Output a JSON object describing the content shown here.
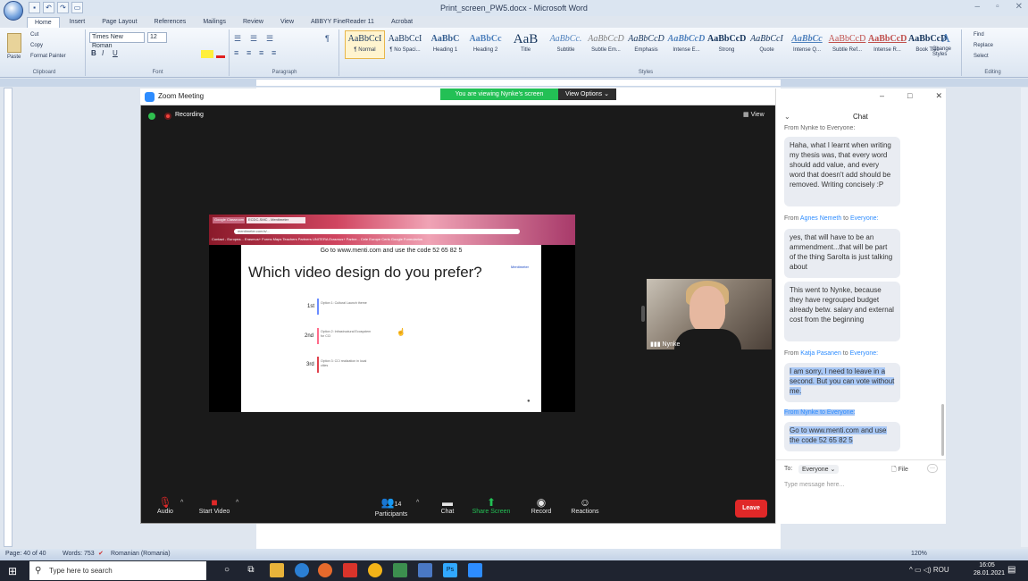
{
  "word": {
    "title": "Print_screen_PW5.docx - Microsoft Word",
    "tabs": [
      "Home",
      "Insert",
      "Page Layout",
      "References",
      "Mailings",
      "Review",
      "View",
      "ABBYY FineReader 11",
      "Acrobat"
    ],
    "clipboard": {
      "paste": "Paste",
      "cut": "Cut",
      "copy": "Copy",
      "format_painter": "Format Painter",
      "group": "Clipboard"
    },
    "font": {
      "name": "Times New Roman",
      "size": "12",
      "group": "Font"
    },
    "paragraph_group": "Paragraph",
    "styles_group": "Styles",
    "styles": [
      {
        "sample": "AaBbCcI",
        "name": "¶ Normal"
      },
      {
        "sample": "AaBbCcI",
        "name": "¶ No Spaci..."
      },
      {
        "sample": "AaBbC",
        "name": "Heading 1"
      },
      {
        "sample": "AaBbCc",
        "name": "Heading 2"
      },
      {
        "sample": "AaB",
        "name": "Title"
      },
      {
        "sample": "AaBbCc.",
        "name": "Subtitle"
      },
      {
        "sample": "AaBbCcD",
        "name": "Subtle Em..."
      },
      {
        "sample": "AaBbCcD",
        "name": "Emphasis"
      },
      {
        "sample": "AaBbCcD",
        "name": "Intense E..."
      },
      {
        "sample": "AaBbCcD",
        "name": "Strong"
      },
      {
        "sample": "AaBbCcI",
        "name": "Quote"
      },
      {
        "sample": "AaBbCc",
        "name": "Intense Q..."
      },
      {
        "sample": "AaBbCcD",
        "name": "Subtle Ref..."
      },
      {
        "sample": "AaBbCcD",
        "name": "Intense R..."
      },
      {
        "sample": "AaBbCcD",
        "name": "Book Title"
      }
    ],
    "change_styles": "Change Styles",
    "editing": {
      "find": "Find",
      "replace": "Replace",
      "select": "Select",
      "group": "Editing"
    },
    "status": {
      "page": "Page: 40 of 40",
      "words": "Words: 753",
      "language": "Romanian (Romania)",
      "zoom": "120%"
    }
  },
  "zoom": {
    "window_title": "Zoom Meeting",
    "viewing_banner": "You are viewing Nynke's screen",
    "view_options": "View Options",
    "recording": "Recording",
    "view_button": "View",
    "shared": {
      "tab1": "Google Classroom",
      "tab2": "ECDC-SMC - Mentimeter",
      "address": "mentimeter.com/s/...",
      "bookmarks": "Contact - Europea...   Erasmus+ Forms   Maps Teachers   Partners UNITERA   Erasmus+ Partne...   Cele Europe Certs   Google Formularios",
      "code_line": "Go to www.menti.com and use the code 52 65 82 5",
      "brand": "Mentimeter",
      "question": "Which video design do you prefer?",
      "ranks": [
        {
          "rank": "1st",
          "option": "Option 1: Cultural Launch theme",
          "color": "#6b8cff"
        },
        {
          "rank": "2nd",
          "option": "Option 2: Infrastructural Ecosystem for CCI",
          "color": "#ff6b8a"
        },
        {
          "rank": "3rd",
          "option": "Option 3: CCI realization in local cities",
          "color": "#e0424d"
        }
      ]
    },
    "participant_name": "Nynke",
    "toolbar": {
      "audio": "Audio",
      "start_video": "Start Video",
      "participants": "Participants",
      "participants_count": "14",
      "chat": "Chat",
      "share_screen": "Share Screen",
      "record": "Record",
      "reactions": "Reactions",
      "leave": "Leave"
    },
    "chat": {
      "title": "Chat",
      "partial_header": "From Nynke to Everyone:",
      "messages": [
        {
          "text": "Haha, what I learnt when writing my thesis was, that every word should add value, and every word that doesn't add should be removed. Writing concisely :P"
        },
        {
          "from": "Agnes Nemeth",
          "to": "Everyone:"
        },
        {
          "text": "yes, that will have to be an ammendment...that will be part of the thing Sarolta is just talking about"
        },
        {
          "text": "This went to Nynke, because they have regrouped budget already betw. salary and external cost from the beginning"
        },
        {
          "from": "Katja Pasanen",
          "to": "Everyone:"
        },
        {
          "text": "I am sorry, I need to leave in a second. But you can vote without me."
        },
        {
          "from": "Nynke",
          "to": "Everyone:"
        },
        {
          "text": "Go to www.menti.com and use the code 52 65 82 5"
        }
      ],
      "from_word": "From",
      "to_word": "to",
      "to_label": "To:",
      "to_value": "Everyone",
      "file": "File",
      "input_placeholder": "Type message here..."
    }
  },
  "taskbar": {
    "search_placeholder": "Type here to search",
    "language": "ROU",
    "time": "16:05",
    "date": "28.01.2021"
  }
}
